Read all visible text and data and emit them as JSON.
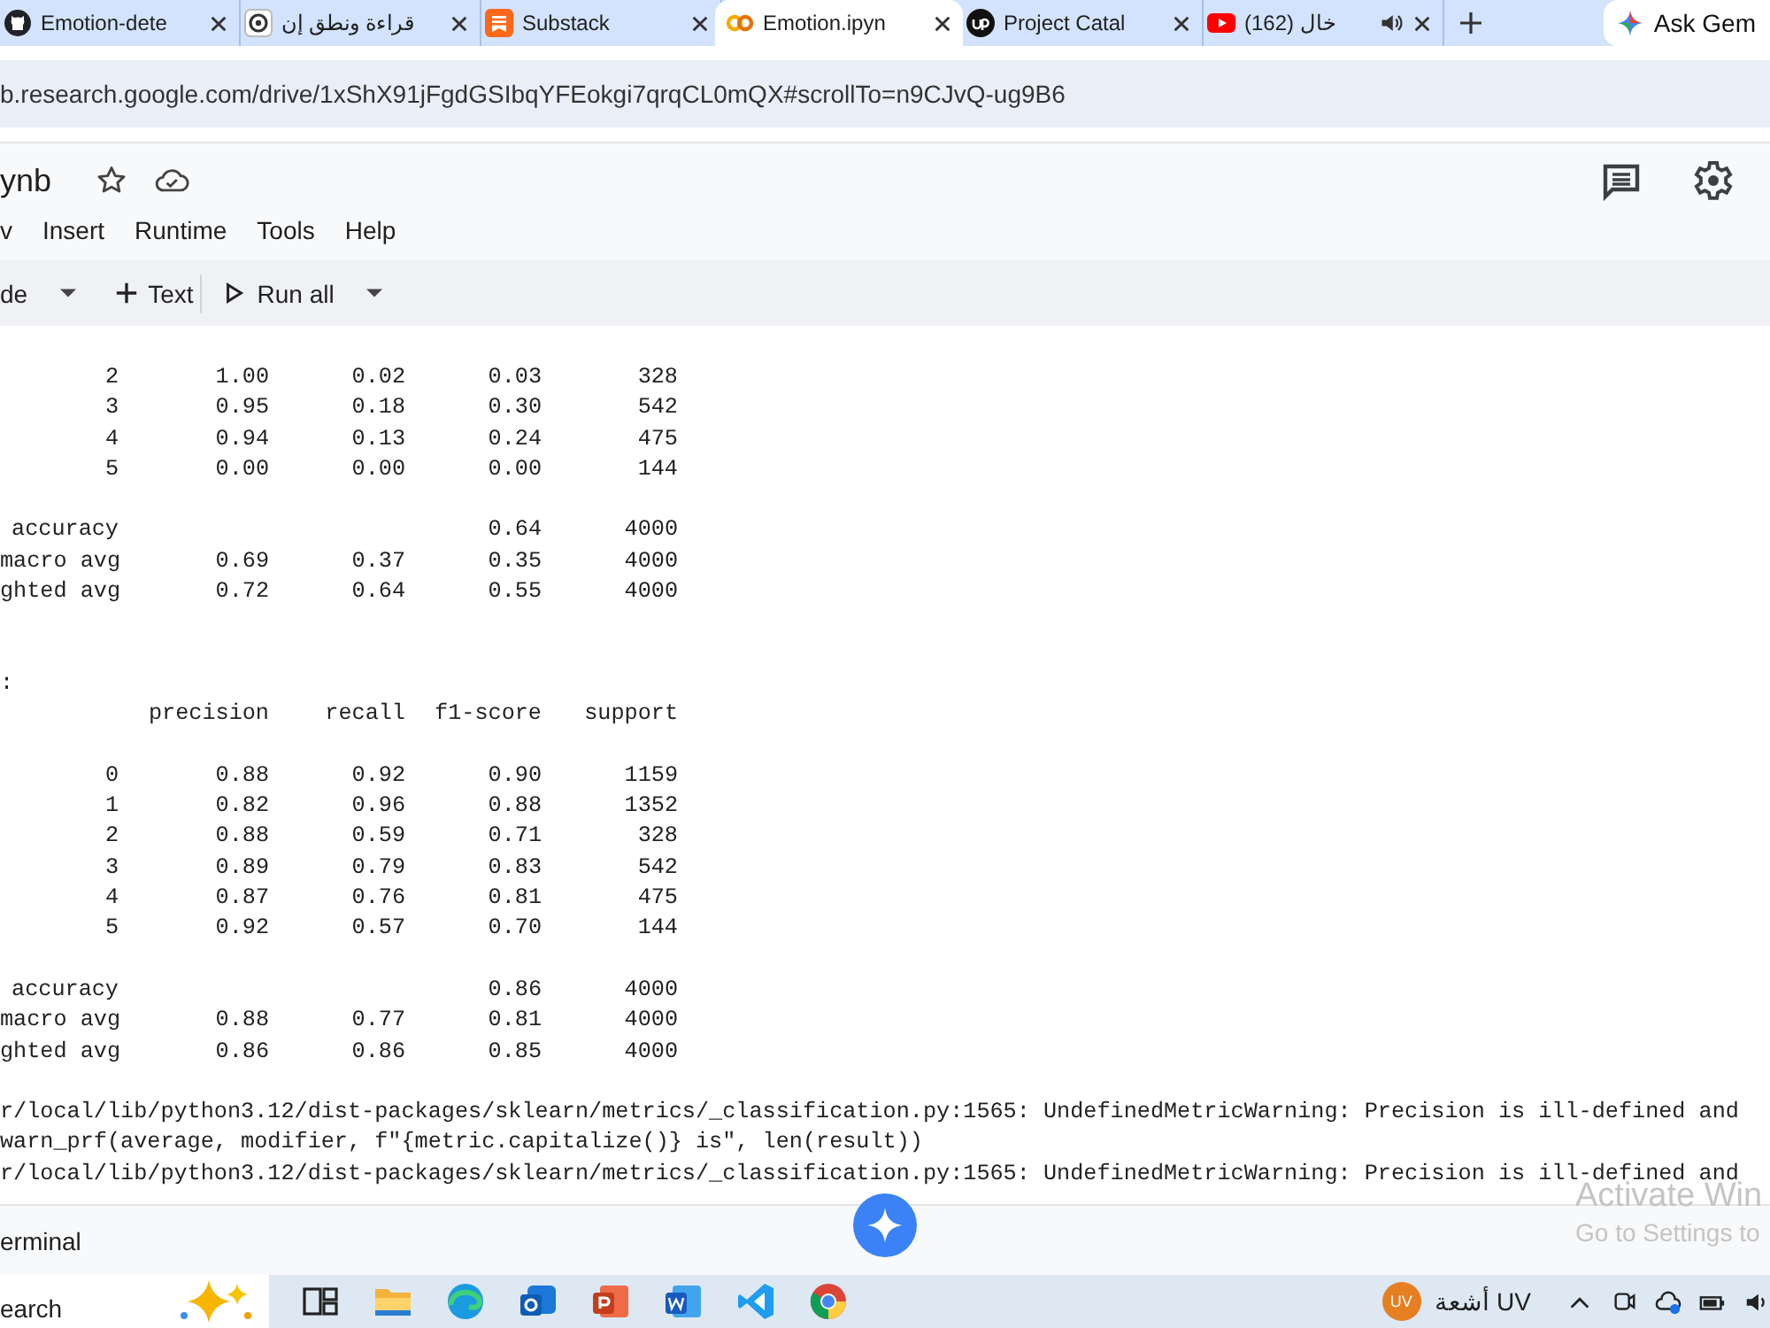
{
  "browser": {
    "tabs": [
      {
        "title": "Emotion-dete",
        "selected": false
      },
      {
        "title": "قراءة ونطق إن",
        "selected": false
      },
      {
        "title": "Substack",
        "selected": false
      },
      {
        "title": "Emotion.ipyn",
        "selected": true
      },
      {
        "title": "Project Catal",
        "selected": false
      },
      {
        "title": "(162) خال",
        "selected": false,
        "audio": true
      }
    ],
    "ask_button": "Ask Gem",
    "address": "b.research.google.com/drive/1xShX91jFgdGSIbqYFEokgi7qrqCL0mQX#scrollTo=n9CJvQ-ug9B6"
  },
  "notebook": {
    "title": "ynb",
    "menu": [
      "v",
      "Insert",
      "Runtime",
      "Tools",
      "Help"
    ],
    "toolbar": [
      {
        "label": "de",
        "kind": "dropdown"
      },
      {
        "label": "Text",
        "kind": "add"
      },
      {
        "label": "Run all",
        "kind": "run"
      }
    ]
  },
  "output": {
    "reports": [
      {
        "rows": [
          {
            "label": "2",
            "precision": "1.00",
            "recall": "0.02",
            "f1_score": "0.03",
            "support": "328"
          },
          {
            "label": "3",
            "precision": "0.95",
            "recall": "0.18",
            "f1_score": "0.30",
            "support": "542"
          },
          {
            "label": "4",
            "precision": "0.94",
            "recall": "0.13",
            "f1_score": "0.24",
            "support": "475"
          },
          {
            "label": "5",
            "precision": "0.00",
            "recall": "0.00",
            "f1_score": "0.00",
            "support": "144"
          }
        ],
        "summary": [
          {
            "label": "accuracy",
            "f1_score": "0.64",
            "support": "4000"
          },
          {
            "label": "macro avg",
            "precision": "0.69",
            "recall": "0.37",
            "f1_score": "0.35",
            "support": "4000"
          },
          {
            "label": "ghted avg",
            "precision": "0.72",
            "recall": "0.64",
            "f1_score": "0.55",
            "support": "4000"
          }
        ]
      },
      {
        "heading": ":",
        "columns": {
          "precision": "precision",
          "recall": "recall",
          "f1_score": "f1-score",
          "support": "support"
        },
        "rows": [
          {
            "label": "0",
            "precision": "0.88",
            "recall": "0.92",
            "f1_score": "0.90",
            "support": "1159"
          },
          {
            "label": "1",
            "precision": "0.82",
            "recall": "0.96",
            "f1_score": "0.88",
            "support": "1352"
          },
          {
            "label": "2",
            "precision": "0.88",
            "recall": "0.59",
            "f1_score": "0.71",
            "support": "328"
          },
          {
            "label": "3",
            "precision": "0.89",
            "recall": "0.79",
            "f1_score": "0.83",
            "support": "542"
          },
          {
            "label": "4",
            "precision": "0.87",
            "recall": "0.76",
            "f1_score": "0.81",
            "support": "475"
          },
          {
            "label": "5",
            "precision": "0.92",
            "recall": "0.57",
            "f1_score": "0.70",
            "support": "144"
          }
        ],
        "summary": [
          {
            "label": "accuracy",
            "f1_score": "0.86",
            "support": "4000"
          },
          {
            "label": "macro avg",
            "precision": "0.88",
            "recall": "0.77",
            "f1_score": "0.81",
            "support": "4000"
          },
          {
            "label": "ghted avg",
            "precision": "0.86",
            "recall": "0.86",
            "f1_score": "0.85",
            "support": "4000"
          }
        ]
      }
    ],
    "warnings": [
      "r/local/lib/python3.12/dist-packages/sklearn/metrics/_classification.py:1565: UndefinedMetricWarning: Precision is ill-defined and",
      "warn_prf(average, modifier, f\"{metric.capitalize()} is\", len(result))",
      "r/local/lib/python3.12/dist-packages/sklearn/metrics/_classification.py:1565: UndefinedMetricWarning: Precision is ill-defined and"
    ]
  },
  "terminal": "erminal",
  "activation_notice": [
    "Activate Win",
    "Go to Settings to"
  ],
  "taskbar": {
    "search": "earch",
    "weather_badge": "UV",
    "weather": "أشعة UV"
  }
}
